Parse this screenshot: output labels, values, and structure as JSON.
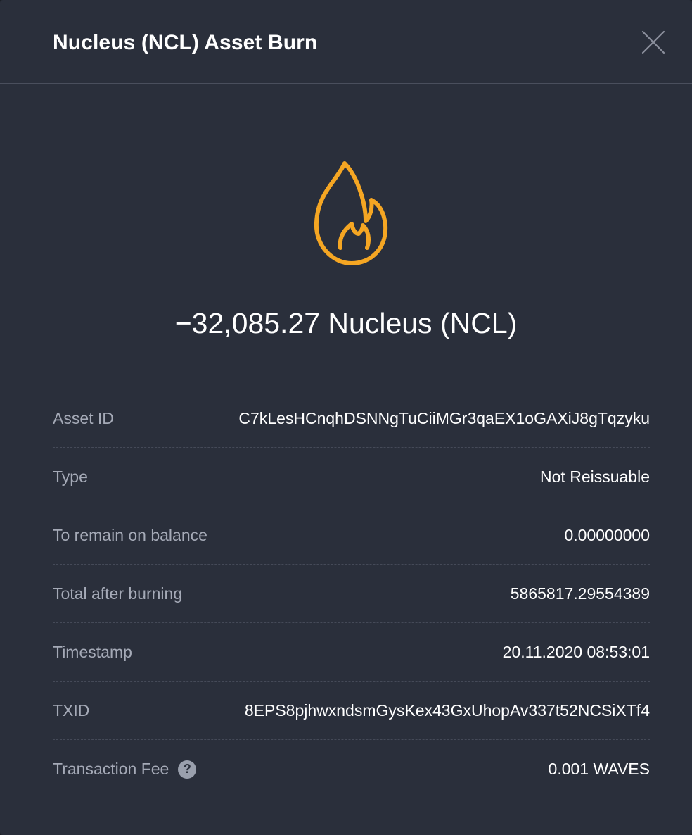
{
  "header": {
    "title": "Nucleus (NCL) Asset Burn"
  },
  "hero": {
    "icon": "fire-icon",
    "icon_color": "#f5a623",
    "amount": "−32,085.27 Nucleus (NCL)"
  },
  "details": [
    {
      "label": "Asset ID",
      "value": "C7kLesHCnqhDSNNgTuCiiMGr3qaEX1oGAXiJ8gTqzyku"
    },
    {
      "label": "Type",
      "value": "Not Reissuable"
    },
    {
      "label": "To remain on balance",
      "value": "0.00000000"
    },
    {
      "label": "Total after burning",
      "value": "5865817.29554389"
    },
    {
      "label": "Timestamp",
      "value": "20.11.2020 08:53:01"
    },
    {
      "label": "TXID",
      "value": "8EPS8pjhwxndsmGysKex43GxUhopAv337t52NCSiXTf4"
    },
    {
      "label": "Transaction Fee",
      "value": "0.001 WAVES",
      "help_icon": "?"
    }
  ],
  "colors": {
    "background": "#2a2f3b",
    "label": "#a5aab7",
    "value": "#ffffff",
    "accent": "#f5a623"
  }
}
